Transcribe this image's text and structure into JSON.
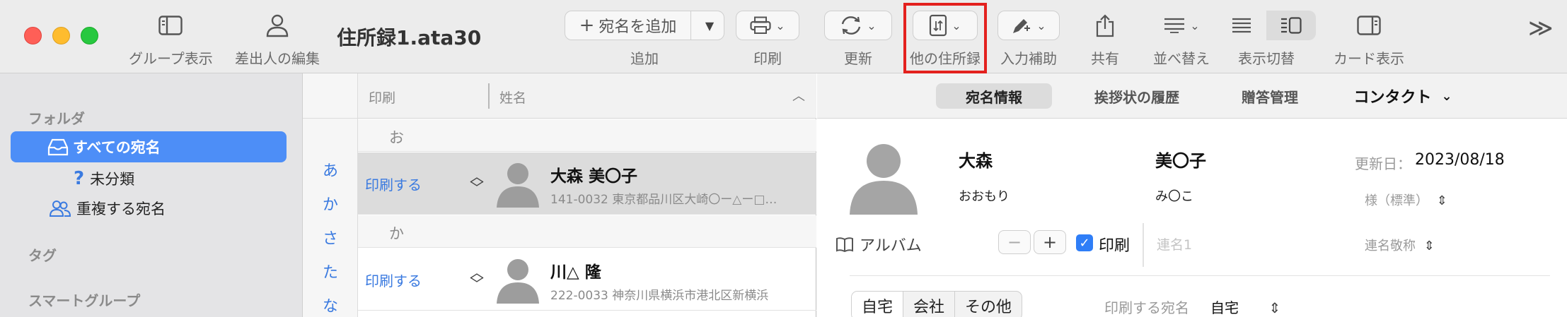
{
  "window": {
    "title": "住所録1.ata30"
  },
  "toolbar": {
    "group_view": "グループ表示",
    "sender_edit": "差出人の編集",
    "add_label": "追加",
    "add_button": "宛名を追加",
    "print": "印刷",
    "update": "更新",
    "other_address_book": "他の住所録",
    "input_assist": "入力補助",
    "share": "共有",
    "sort": "並べ替え",
    "view_switch": "表示切替",
    "card_view": "カード表示",
    "overflow_glyph": "≫"
  },
  "sidebar": {
    "folder_header": "フォルダ",
    "all_addresses": "すべての宛名",
    "uncategorized": "未分類",
    "duplicates": "重複する宛名",
    "tag_header": "タグ",
    "smart_group_header": "スマートグループ"
  },
  "index": [
    "あ",
    "か",
    "さ",
    "た",
    "な"
  ],
  "list": {
    "col_print": "印刷",
    "col_name": "姓名",
    "sections": [
      "お",
      "か"
    ],
    "rows": [
      {
        "print": "印刷する",
        "name": "大森 美〇子",
        "address": "141-0032 東京都品川区大崎〇ー△ー□…"
      },
      {
        "print": "印刷する",
        "name": "川△ 隆",
        "address": "222-0033 神奈川県横浜市港北区新横浜"
      }
    ]
  },
  "detail": {
    "tabs": [
      "宛名情報",
      "挨拶状の履歴",
      "贈答管理",
      "コンタクト"
    ],
    "last_name": "大森",
    "first_name": "美〇子",
    "last_name_kana": "おおもり",
    "first_name_kana": "み〇こ",
    "updated_label": "更新日：",
    "updated_value": "2023/08/18",
    "honorific": "様（標準）",
    "album_label": "アルバム",
    "minus": "−",
    "plus": "+",
    "print_label": "印刷",
    "joint_name_placeholder": "連名1",
    "joint_honorific": "連名敬称",
    "address_tabs": [
      "自宅",
      "会社",
      "その他"
    ],
    "print_address_label": "印刷する宛名",
    "print_address_value": "自宅"
  },
  "colors": {
    "accent": "#4d8ef7",
    "highlight": "#e3211e",
    "link": "#3a7ae0"
  }
}
